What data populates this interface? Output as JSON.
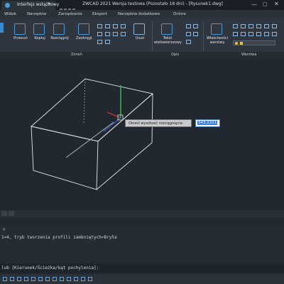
{
  "titlebar": {
    "workspace": "Interfejs wstążkowy",
    "workspace_chevron": "▾",
    "window_title": "ZWCAD 2021 Wersja testowa (Pozostało 18 dni) - [Rysunek1.dwg]",
    "min": "—",
    "max": "▢",
    "close": "✕"
  },
  "menu_tabs": [
    "Widok",
    "Narzędzia",
    "Zarządzanie",
    "Eksport",
    "Narzędzia dodatkowe",
    "Online"
  ],
  "ribbon": {
    "buttons": {
      "przesun": "Przesuń",
      "kopiuj": "Kopiuj",
      "rozciagnij": "Rozciągnij",
      "zaokraglij": "Zaokrągl.",
      "usun": "Usuń",
      "tekst": "Tekst wielowierszowy",
      "wlasciwosci": "Właściwości warstwy"
    },
    "panels": {
      "zmien": "Zmień",
      "opis": "Opis",
      "warstwa": "Warstwa"
    }
  },
  "viewport": {
    "tooltip_label": "Określ wysokość rozciągnięcia:",
    "tooltip_value": "343.2221"
  },
  "command": {
    "history": "1=4, tryb tworzenia profili zamkniętych=Bryła",
    "prompt": "lub [Kierunek/Ścieżka/kąt pochylenia]:"
  }
}
